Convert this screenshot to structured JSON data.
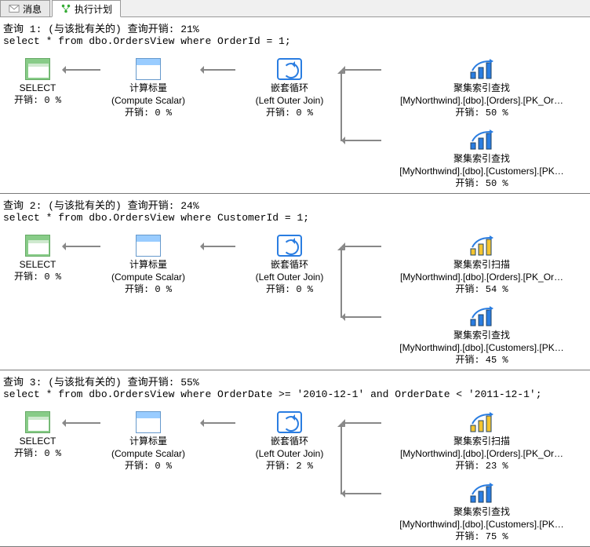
{
  "tabs": [
    {
      "label": "消息",
      "active": false
    },
    {
      "label": "执行计划",
      "active": true
    }
  ],
  "common": {
    "select": "SELECT",
    "compute": "计算标量",
    "computeSub": "(Compute Scalar)",
    "loop": "嵌套循环",
    "loopSub": "(Left Outer Join)",
    "indexSeek": "聚集索引查找",
    "indexScan": "聚集索引扫描",
    "ordersIdx": "[MyNorthwind].[dbo].[Orders].[PK_Or…",
    "custIdx": "[MyNorthwind].[dbo].[Customers].[PK…",
    "costLabel": "开销: "
  },
  "queries": [
    {
      "header": "查询 1: (与该批有关的) 查询开销: 21%",
      "sql": "select * from dbo.OrdersView where OrderId = 1;",
      "selectCost": "0 %",
      "computeCost": "0 %",
      "loopCost": "0 %",
      "top": {
        "type": "seek",
        "cost": "50 %"
      },
      "bottom": {
        "type": "seek",
        "cost": "50 %"
      }
    },
    {
      "header": "查询 2: (与该批有关的) 查询开销: 24%",
      "sql": "select * from dbo.OrdersView where CustomerId = 1;",
      "selectCost": "0 %",
      "computeCost": "0 %",
      "loopCost": "0 %",
      "top": {
        "type": "scan",
        "cost": "54 %"
      },
      "bottom": {
        "type": "seek",
        "cost": "45 %"
      }
    },
    {
      "header": "查询 3: (与该批有关的) 查询开销: 55%",
      "sql": "select * from dbo.OrdersView where OrderDate >= '2010-12-1' and OrderDate < '2011-12-1';",
      "selectCost": "0 %",
      "computeCost": "0 %",
      "loopCost": "2 %",
      "top": {
        "type": "scan",
        "cost": "23 %"
      },
      "bottom": {
        "type": "seek",
        "cost": "75 %"
      }
    }
  ]
}
